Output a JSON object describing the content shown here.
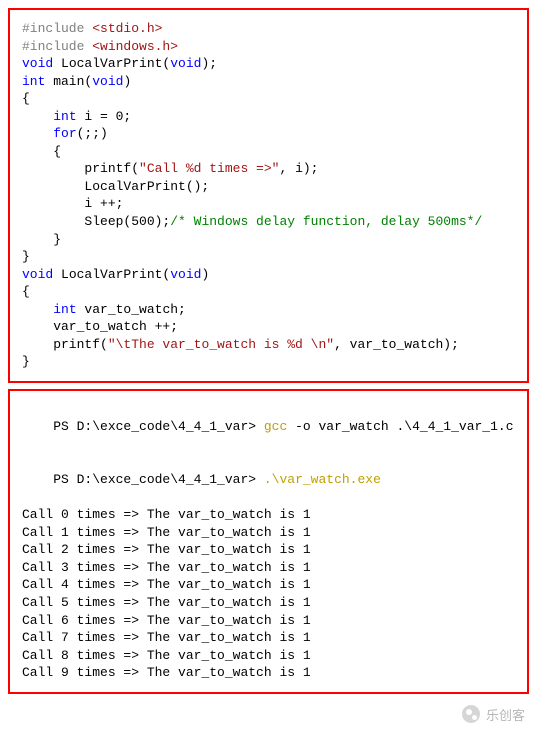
{
  "code": {
    "lines": [
      [
        [
          "include",
          "#include "
        ],
        [
          "header",
          "<stdio.h>"
        ]
      ],
      [
        [
          "include",
          "#include "
        ],
        [
          "header",
          "<windows.h>"
        ]
      ],
      [
        [
          "keyword",
          "void"
        ],
        [
          "plain",
          " LocalVarPrint("
        ],
        [
          "keyword",
          "void"
        ],
        [
          "plain",
          ");"
        ]
      ],
      [
        [
          "keyword",
          "int"
        ],
        [
          "plain",
          " main("
        ],
        [
          "keyword",
          "void"
        ],
        [
          "plain",
          ")"
        ]
      ],
      [
        [
          "plain",
          "{"
        ]
      ],
      [
        [
          "plain",
          "    "
        ],
        [
          "keyword",
          "int"
        ],
        [
          "plain",
          " i = 0;"
        ]
      ],
      [
        [
          "plain",
          "    "
        ],
        [
          "keyword",
          "for"
        ],
        [
          "plain",
          "(;;)"
        ]
      ],
      [
        [
          "plain",
          "    {"
        ]
      ],
      [
        [
          "plain",
          "        printf("
        ],
        [
          "string",
          "\"Call %d times =>\""
        ],
        [
          "plain",
          ", i);"
        ]
      ],
      [
        [
          "plain",
          "        LocalVarPrint();"
        ]
      ],
      [
        [
          "plain",
          "        i ++;"
        ]
      ],
      [
        [
          "plain",
          "        Sleep(500);"
        ],
        [
          "comment",
          "/* Windows delay function, delay 500ms*/"
        ]
      ],
      [
        [
          "plain",
          "    }"
        ]
      ],
      [
        [
          "plain",
          "}"
        ]
      ],
      [
        [
          "plain",
          ""
        ]
      ],
      [
        [
          "keyword",
          "void"
        ],
        [
          "plain",
          " LocalVarPrint("
        ],
        [
          "keyword",
          "void"
        ],
        [
          "plain",
          ")"
        ]
      ],
      [
        [
          "plain",
          "{"
        ]
      ],
      [
        [
          "plain",
          "    "
        ],
        [
          "keyword",
          "int"
        ],
        [
          "plain",
          " var_to_watch;"
        ]
      ],
      [
        [
          "plain",
          "    var_to_watch ++;"
        ]
      ],
      [
        [
          "plain",
          "    printf("
        ],
        [
          "string",
          "\"\\tThe var_to_watch is %d \\n\""
        ],
        [
          "plain",
          ", var_to_watch);"
        ]
      ],
      [
        [
          "plain",
          "}"
        ]
      ]
    ]
  },
  "terminal": {
    "prompt1_prefix": "PS D:\\exce_code\\4_4_1_var> ",
    "prompt1_cmd": "gcc",
    "prompt1_rest": " -o var_watch .\\4_4_1_var_1.c",
    "prompt2_prefix": "PS D:\\exce_code\\4_4_1_var> ",
    "prompt2_cmd": ".\\var_watch.exe",
    "output": [
      "Call 0 times =>\tThe var_to_watch is 1",
      "Call 1 times =>\tThe var_to_watch is 1",
      "Call 2 times =>\tThe var_to_watch is 1",
      "Call 3 times =>\tThe var_to_watch is 1",
      "Call 4 times =>\tThe var_to_watch is 1",
      "Call 5 times =>\tThe var_to_watch is 1",
      "Call 6 times =>\tThe var_to_watch is 1",
      "Call 7 times =>\tThe var_to_watch is 1",
      "Call 8 times =>\tThe var_to_watch is 1",
      "Call 9 times =>\tThe var_to_watch is 1"
    ]
  },
  "watermark": "乐创客"
}
